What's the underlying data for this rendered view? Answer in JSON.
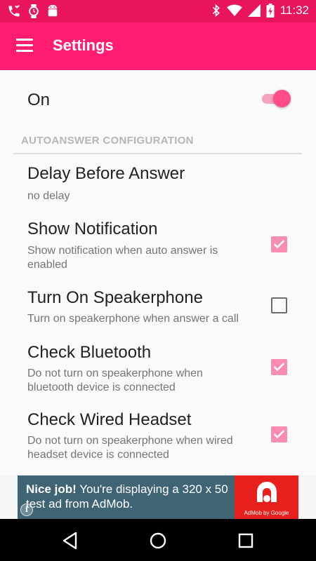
{
  "statusbar": {
    "time": "11:32",
    "icons": [
      "missed-call-icon",
      "watch-icon",
      "android-icon",
      "bluetooth-icon",
      "wifi-icon",
      "signal-icon",
      "battery-charging-icon"
    ]
  },
  "appbar": {
    "title": "Settings",
    "menu_icon": "hamburger-menu-icon"
  },
  "master_switch": {
    "label": "On",
    "enabled": true
  },
  "section": {
    "header": "AUTOANSWER CONFIGURATION"
  },
  "preferences": [
    {
      "title": "Delay Before Answer",
      "summary": "no delay"
    },
    {
      "title": "Show Notification",
      "summary": "Show notification when auto answer is enabled",
      "checked": true
    },
    {
      "title": "Turn On Speakerphone",
      "summary": "Turn on speakerphone when answer a call",
      "checked": false
    },
    {
      "title": "Check Bluetooth",
      "summary": "Do not turn on speakerphone when bluetooth device is connected",
      "checked": true
    },
    {
      "title": "Check Wired Headset",
      "summary": "Do not turn on speakerphone when wired headset device is connected",
      "checked": true
    }
  ],
  "ad": {
    "headline": "Nice job!",
    "body": " You're displaying a 320 x 50 test ad from AdMob.",
    "logo_label": "AdMob by Google",
    "info_glyph": "i"
  },
  "colors": {
    "statusbar": "#e8145e",
    "appbar": "#ff1d71",
    "accent": "#ff4d8a",
    "checkbox_checked": "#f98cb1",
    "ad_background": "#3f6473",
    "ad_logo": "#e8201e"
  },
  "navbar": {
    "icons": [
      "back-icon",
      "home-icon",
      "recents-icon"
    ]
  }
}
